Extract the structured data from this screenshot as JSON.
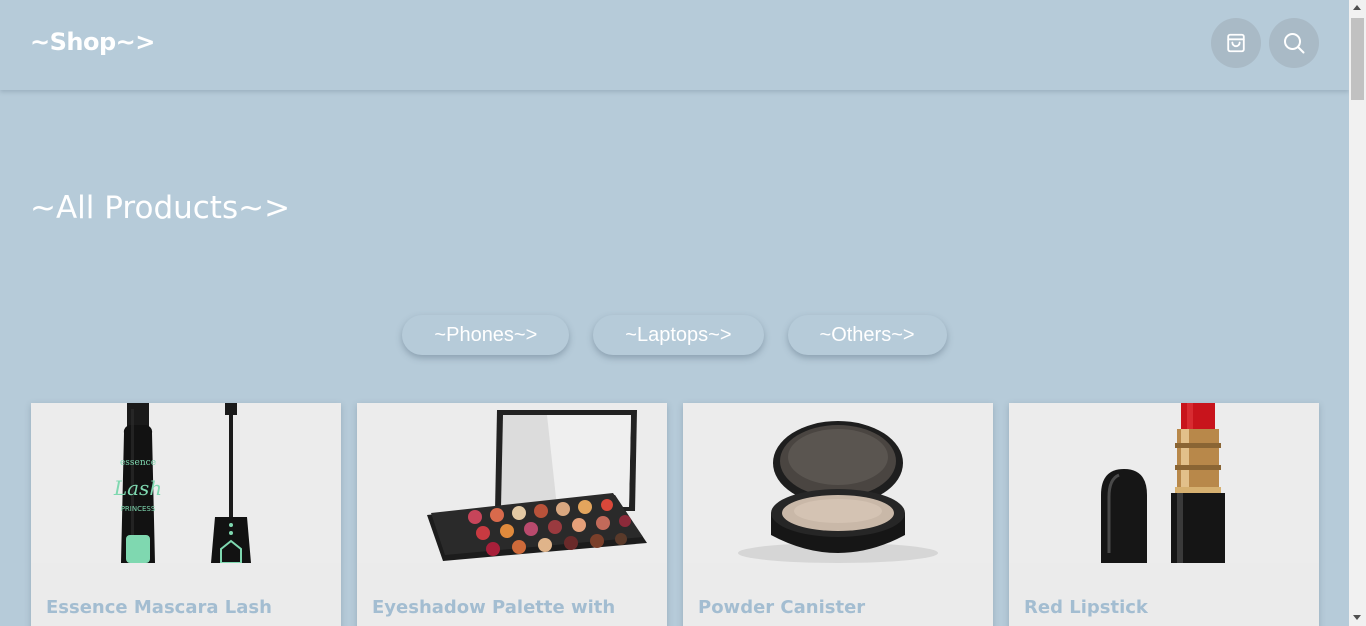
{
  "header": {
    "logo": "~Shop~>",
    "cart_icon": "shopping-bag-icon",
    "search_icon": "search-icon"
  },
  "main": {
    "title": "~All Products~>",
    "filters": [
      "~Phones~>",
      "~Laptops~>",
      "~Others~>"
    ],
    "products": [
      {
        "title": "Essence Mascara Lash",
        "image": "mascara"
      },
      {
        "title": "Eyeshadow Palette with",
        "image": "eyeshadow-palette"
      },
      {
        "title": "Powder Canister",
        "image": "powder-compact"
      },
      {
        "title": "Red Lipstick",
        "image": "lipstick"
      }
    ]
  },
  "colors": {
    "background": "#b6cbd9",
    "card": "#ebebeb",
    "product_title": "#a3bdd1",
    "icon_button": "#a9bac6"
  }
}
